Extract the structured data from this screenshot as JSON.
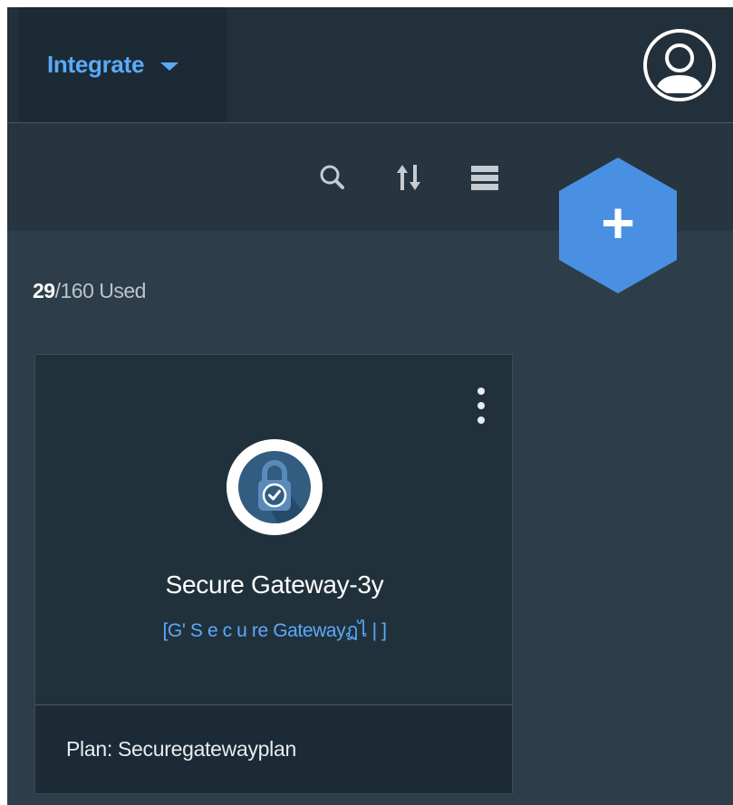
{
  "topbar": {
    "menu_label": "Integrate",
    "menu_icon": "chevron-down-icon",
    "avatar_icon": "user-avatar-icon"
  },
  "toolbar": {
    "icons": [
      "search-icon",
      "sort-icon",
      "list-view-icon"
    ],
    "add_label": "+"
  },
  "usage": {
    "used": "29",
    "rest": "/160 Used"
  },
  "card": {
    "icon": "lock-check-icon",
    "title": "Secure Gateway-3y",
    "subtitle": "[G' S  e  c  u re Gatewayฏไ | ]",
    "plan": "Plan: Securegatewayplan",
    "menu_icon": "overflow-menu-icon"
  },
  "colors": {
    "accent": "#5aaafa",
    "add_button": "#4a90e2",
    "background": "#2d3e4a",
    "header": "#22303b"
  }
}
